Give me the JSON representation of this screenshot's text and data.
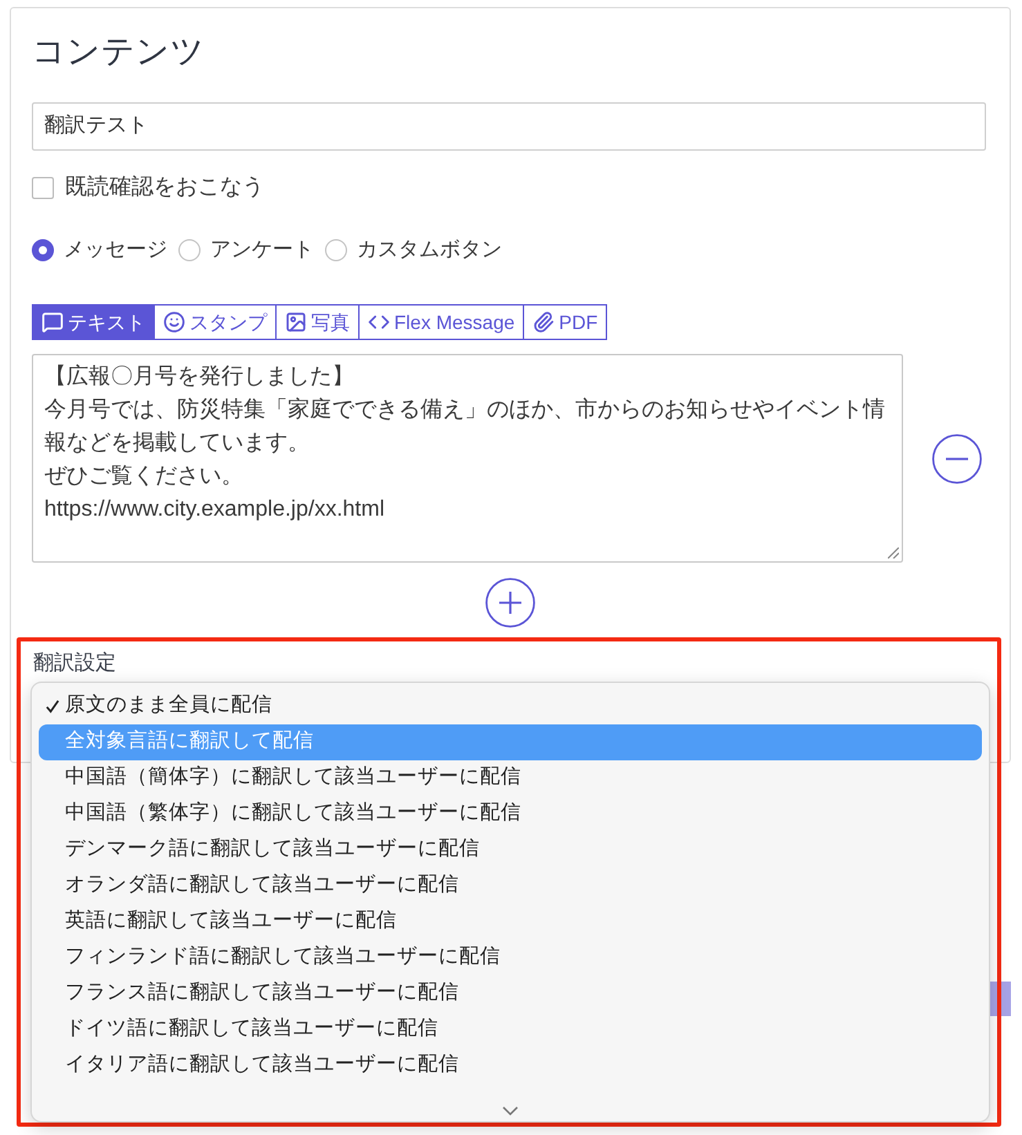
{
  "content": {
    "title": "コンテンツ",
    "name_field": {
      "value": "翻訳テスト"
    },
    "read_receipt": {
      "label": "既読確認をおこなう",
      "checked": false
    },
    "message_types": [
      {
        "label": "メッセージ",
        "selected": true
      },
      {
        "label": "アンケート",
        "selected": false
      },
      {
        "label": "カスタムボタン",
        "selected": false
      }
    ],
    "tabs": [
      {
        "label": "テキスト",
        "kind": "text",
        "selected": true
      },
      {
        "label": "スタンプ",
        "kind": "sticker",
        "selected": false
      },
      {
        "label": "写真",
        "kind": "photo",
        "selected": false
      },
      {
        "label": "Flex Message",
        "kind": "flex",
        "selected": false
      },
      {
        "label": "PDF",
        "kind": "pdf",
        "selected": false
      }
    ],
    "message_text": {
      "lines": [
        "【広報〇月号を発行しました】",
        "今月号では、防災特集「家庭でできる備え」のほか、市からのお知らせやイベント情報などを掲載しています。",
        "ぜひご覧ください。",
        "https://www.city.example.jp/xx.html"
      ]
    }
  },
  "translation": {
    "label": "翻訳設定",
    "options": [
      {
        "label": "原文のまま全員に配信",
        "checked": true,
        "highlighted": false
      },
      {
        "label": "全対象言語に翻訳して配信",
        "checked": false,
        "highlighted": true
      },
      {
        "label": "中国語（簡体字）に翻訳して該当ユーザーに配信",
        "checked": false,
        "highlighted": false
      },
      {
        "label": "中国語（繁体字）に翻訳して該当ユーザーに配信",
        "checked": false,
        "highlighted": false
      },
      {
        "label": "デンマーク語に翻訳して該当ユーザーに配信",
        "checked": false,
        "highlighted": false
      },
      {
        "label": "オランダ語に翻訳して該当ユーザーに配信",
        "checked": false,
        "highlighted": false
      },
      {
        "label": "英語に翻訳して該当ユーザーに配信",
        "checked": false,
        "highlighted": false
      },
      {
        "label": "フィンランド語に翻訳して該当ユーザーに配信",
        "checked": false,
        "highlighted": false
      },
      {
        "label": "フランス語に翻訳して該当ユーザーに配信",
        "checked": false,
        "highlighted": false
      },
      {
        "label": "ドイツ語に翻訳して該当ユーザーに配信",
        "checked": false,
        "highlighted": false
      },
      {
        "label": "イタリア語に翻訳して該当ユーザーに配信",
        "checked": false,
        "highlighted": false
      }
    ]
  }
}
